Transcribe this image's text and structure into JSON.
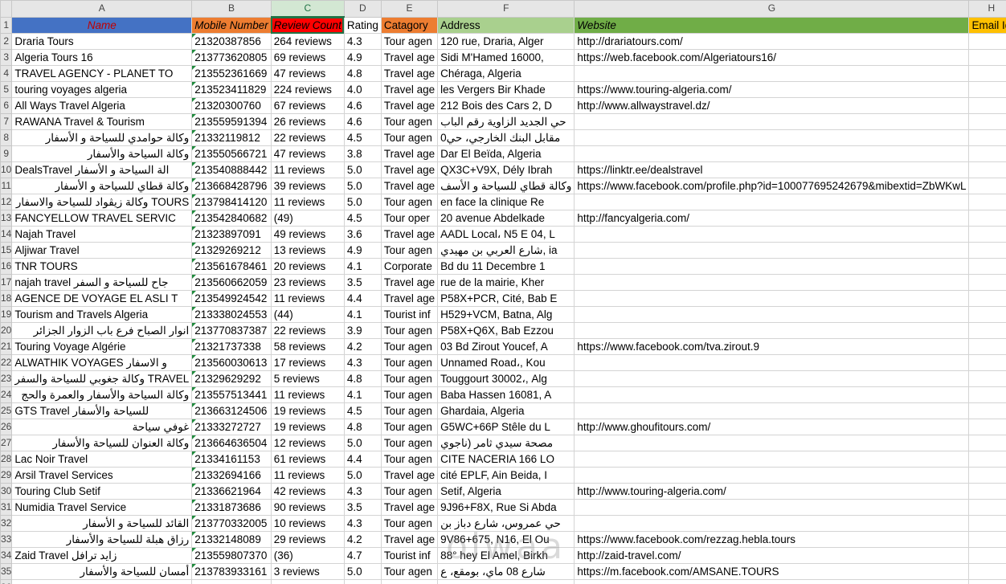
{
  "column_letters": [
    "A",
    "B",
    "C",
    "D",
    "E",
    "F",
    "G",
    "H"
  ],
  "selected_column": "C",
  "header": {
    "name": "Name",
    "mobile": "Mobile Number",
    "review": "Review Count",
    "rating": "Rating",
    "category": "Catagory",
    "address": "Address",
    "website": "Website",
    "email": "Email Id"
  },
  "header_colors": {
    "name": "#4472c4",
    "mobile": "#ed7d31",
    "review": "#ff0000",
    "category": "#ed7d31",
    "address": "#a9d08e",
    "website": "#70ad47",
    "email": "#ffc000"
  },
  "rows": [
    {
      "n": "2",
      "name": "Draria Tours",
      "mobile": "21320387856",
      "reviews": "264 reviews",
      "rating": "4.3",
      "category": "Tour agen",
      "address": "120 rue, Draria, Alger",
      "website": "http://drariatours.com/",
      "email": "",
      "rtl": false
    },
    {
      "n": "3",
      "name": "Algeria Tours 16",
      "mobile": "213773620805",
      "reviews": "69 reviews",
      "rating": "4.9",
      "category": "Travel age",
      "address": "Sidi M'Hamed 16000,",
      "website": "https://web.facebook.com/Algeriatours16/",
      "email": "",
      "rtl": false
    },
    {
      "n": "4",
      "name": "TRAVEL AGENCY - PLANET TO",
      "mobile": "213552361669",
      "reviews": "47 reviews",
      "rating": "4.8",
      "category": "Travel age",
      "address": "Chéraga, Algeria",
      "website": "",
      "email": "",
      "rtl": false
    },
    {
      "n": "5",
      "name": "touring voyages algeria",
      "mobile": "213523411829",
      "reviews": "224 reviews",
      "rating": "4.0",
      "category": "Travel age",
      "address": "les Vergers Bir Khade",
      "website": "https://www.touring-algeria.com/",
      "email": "",
      "rtl": false
    },
    {
      "n": "6",
      "name": "All Ways Travel Algeria",
      "mobile": "21320300760",
      "reviews": "67 reviews",
      "rating": "4.6",
      "category": "Travel age",
      "address": "212 Bois des Cars 2, D",
      "website": "http://www.allwaystravel.dz/",
      "email": "",
      "rtl": false
    },
    {
      "n": "7",
      "name": "RAWANA Travel & Tourism",
      "mobile": "213559591394",
      "reviews": "26 reviews",
      "rating": "4.6",
      "category": "Tour agen",
      "address": "حي الجديد الزاوية رقم الباب",
      "website": "",
      "email": "",
      "rtl": false
    },
    {
      "n": "8",
      "name": "وكالة حوامدي للسياحة و الأسفار",
      "mobile": "21332119812",
      "reviews": "22 reviews",
      "rating": "4.5",
      "category": "Tour agen",
      "address": "مقابل البنك الخارجي، حي0",
      "website": "",
      "email": "",
      "rtl": true
    },
    {
      "n": "9",
      "name": "وكالة السياحة والأسفار",
      "mobile": "213550566721",
      "reviews": "47 reviews",
      "rating": "3.8",
      "category": "Travel age",
      "address": "Dar El Beïda, Algeria",
      "website": "",
      "email": "",
      "rtl": true
    },
    {
      "n": "10",
      "name": "DealsTravel الة السياحة و الأسفار",
      "mobile": "213540888442",
      "reviews": "11 reviews",
      "rating": "5.0",
      "category": "Travel age",
      "address": "QX3C+V9X, Dély Ibrah",
      "website": "https://linktr.ee/dealstravel",
      "email": "",
      "rtl": false
    },
    {
      "n": "11",
      "name": "وكالة قطاي للسياحة و الأسفار",
      "mobile": "213668428796",
      "reviews": "39 reviews",
      "rating": "5.0",
      "category": "Travel age",
      "address": "وكالة قطاي للسياحة و الأسف",
      "website": "https://www.facebook.com/profile.php?id=100077695242679&mibextid=ZbWKwL",
      "email": "",
      "rtl": true
    },
    {
      "n": "12",
      "name": "TOURS وكالة زيڨواد للسياحة والاسفار",
      "mobile": "213798414120",
      "reviews": "11 reviews",
      "rating": "5.0",
      "category": "Tour agen",
      "address": "en face la clinique Re",
      "website": "",
      "email": "",
      "rtl": true
    },
    {
      "n": "13",
      "name": "FANCYELLOW TRAVEL SERVIC",
      "mobile": "213542840682",
      "reviews": "(49)",
      "rating": "4.5",
      "category": "Tour oper",
      "address": "20 avenue Abdelkade",
      "website": "http://fancyalgeria.com/",
      "email": "",
      "rtl": false
    },
    {
      "n": "14",
      "name": "Najah Travel",
      "mobile": "21323897091",
      "reviews": "49 reviews",
      "rating": "3.6",
      "category": "Travel age",
      "address": "AADL Local، N5 E 04, L",
      "website": "",
      "email": "",
      "rtl": false
    },
    {
      "n": "15",
      "name": "Aljiwar Travel",
      "mobile": "21329269212",
      "reviews": "13 reviews",
      "rating": "4.9",
      "category": "Tour agen",
      "address": "شارع العربي بن مهيدي, ia",
      "website": "",
      "email": "",
      "rtl": false
    },
    {
      "n": "16",
      "name": "TNR TOURS",
      "mobile": "213561678461",
      "reviews": "20 reviews",
      "rating": "4.1",
      "category": "Corporate",
      "address": "Bd du 11 Decembre 1",
      "website": "",
      "email": "",
      "rtl": false
    },
    {
      "n": "17",
      "name": "najah travel جاح للسياحة و السفر",
      "mobile": "213560662059",
      "reviews": "23 reviews",
      "rating": "3.5",
      "category": "Travel age",
      "address": "rue de la mairie, Kher",
      "website": "",
      "email": "",
      "rtl": false
    },
    {
      "n": "18",
      "name": "AGENCE DE VOYAGE EL ASLI T",
      "mobile": "213549924542",
      "reviews": "11 reviews",
      "rating": "4.4",
      "category": "Travel age",
      "address": "P58X+PCR, Cité, Bab E",
      "website": "",
      "email": "",
      "rtl": false
    },
    {
      "n": "19",
      "name": "Tourism and Travels Algeria",
      "mobile": "213338024553",
      "reviews": "(44)",
      "rating": "4.1",
      "category": "Tourist inf",
      "address": "H529+VCM, Batna, Alg",
      "website": "",
      "email": "",
      "rtl": false
    },
    {
      "n": "20",
      "name": "انوار الصباح فرع باب الزوار الجزائر",
      "mobile": "213770837387",
      "reviews": "22 reviews",
      "rating": "3.9",
      "category": "Tour agen",
      "address": "P58X+Q6X, Bab Ezzou",
      "website": "",
      "email": "",
      "rtl": true
    },
    {
      "n": "21",
      "name": "Touring Voyage Algérie",
      "mobile": "21321737338",
      "reviews": "58 reviews",
      "rating": "4.2",
      "category": "Tour agen",
      "address": "03 Bd Zirout Youcef, A",
      "website": "https://www.facebook.com/tva.zirout.9",
      "email": "",
      "rtl": false
    },
    {
      "n": "22",
      "name": "ALWATHIK VOYAGES و الاسفار",
      "mobile": "213560030613",
      "reviews": "17 reviews",
      "rating": "4.3",
      "category": "Tour agen",
      "address": "Unnamed Road،, Kou",
      "website": "",
      "email": "",
      "rtl": false
    },
    {
      "n": "23",
      "name": "TRAVEL وكالة جغوبي للسياحة والسفر",
      "mobile": "21329629292",
      "reviews": "5 reviews",
      "rating": "4.8",
      "category": "Tour agen",
      "address": "Touggourt 30002،, Alg",
      "website": "",
      "email": "",
      "rtl": true
    },
    {
      "n": "24",
      "name": "وكالة السياحة والأسفار والعمرة والحج",
      "mobile": "213557513441",
      "reviews": "11 reviews",
      "rating": "4.1",
      "category": "Tour agen",
      "address": "Baba Hassen 16081, A",
      "website": "",
      "email": "",
      "rtl": true
    },
    {
      "n": "25",
      "name": "GTS Travel للسياحة والأسفار",
      "mobile": "213663124506",
      "reviews": "19 reviews",
      "rating": "4.5",
      "category": "Tour agen",
      "address": "Ghardaia, Algeria",
      "website": "",
      "email": "",
      "rtl": false
    },
    {
      "n": "26",
      "name": "غوفي سياحة",
      "mobile": "21333272727",
      "reviews": "19 reviews",
      "rating": "4.8",
      "category": "Tour agen",
      "address": "G5WC+66P Stêle du L",
      "website": "http://www.ghoufitours.com/",
      "email": "",
      "rtl": true
    },
    {
      "n": "27",
      "name": "وكالة العنوان للسياحة والأسفار",
      "mobile": "213664636504",
      "reviews": "12 reviews",
      "rating": "5.0",
      "category": "Tour agen",
      "address": "مصحة سيدي ثامر (ناجوي",
      "website": "",
      "email": "",
      "rtl": true
    },
    {
      "n": "28",
      "name": "Lac Noir Travel",
      "mobile": "21334161153",
      "reviews": "61 reviews",
      "rating": "4.4",
      "category": "Tour agen",
      "address": "CITE NACERIA 166 LO",
      "website": "",
      "email": "",
      "rtl": false
    },
    {
      "n": "29",
      "name": "Arsil Travel Services",
      "mobile": "21332694166",
      "reviews": "11 reviews",
      "rating": "5.0",
      "category": "Travel age",
      "address": "cité EPLF, Ain Beida, I",
      "website": "",
      "email": "",
      "rtl": false
    },
    {
      "n": "30",
      "name": "Touring Club Setif",
      "mobile": "21336621964",
      "reviews": "42 reviews",
      "rating": "4.3",
      "category": "Tour agen",
      "address": "Setif, Algeria",
      "website": "http://www.touring-algeria.com/",
      "email": "",
      "rtl": false
    },
    {
      "n": "31",
      "name": "Numidia Travel Service",
      "mobile": "21331873686",
      "reviews": "90 reviews",
      "rating": "3.5",
      "category": "Travel age",
      "address": "9J96+F8X, Rue Si Abda",
      "website": "",
      "email": "",
      "rtl": false
    },
    {
      "n": "32",
      "name": "القائد للسياحة و الأسفار",
      "mobile": "213770332005",
      "reviews": "10 reviews",
      "rating": "4.3",
      "category": "Tour agen",
      "address": "حي عمروس، شارع دباز بن",
      "website": "",
      "email": "",
      "rtl": true
    },
    {
      "n": "33",
      "name": "رزاق هبلة للسياحة والأسفار",
      "mobile": "21332148089",
      "reviews": "29 reviews",
      "rating": "4.2",
      "category": "Travel age",
      "address": "9V86+675, N16, El Ou",
      "website": "https://www.facebook.com/rezzag.hebla.tours",
      "email": "",
      "rtl": true
    },
    {
      "n": "34",
      "name": "Zaid Travel زايد ترافل",
      "mobile": "213559807370",
      "reviews": "(36)",
      "rating": "4.7",
      "category": "Tourist inf",
      "address": "88° hey El Amel, Birkh",
      "website": "http://zaid-travel.com/",
      "email": "",
      "rtl": false
    },
    {
      "n": "35",
      "name": "أمسان للسياحة والأسفار",
      "mobile": "213783933161",
      "reviews": "3 reviews",
      "rating": "5.0",
      "category": "Tour agen",
      "address": "شارع 08 ماي، بومقع، ع",
      "website": "https://m.facebook.com/AMSANE.TOURS",
      "email": "",
      "rtl": true
    },
    {
      "n": "36",
      "name": "",
      "mobile": "",
      "reviews": "",
      "rating": "",
      "category": "",
      "address": "",
      "website": "",
      "email": "",
      "rtl": false
    }
  ],
  "watermark": "olwaa"
}
